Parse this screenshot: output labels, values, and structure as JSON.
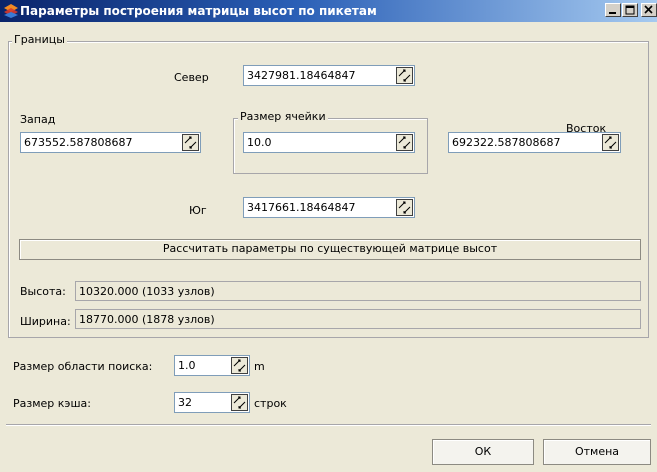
{
  "window": {
    "title": "Параметры построения матрицы высот по пикетам"
  },
  "bounds": {
    "legend": "Границы",
    "north": {
      "label": "Север",
      "value": "3427981.18464847"
    },
    "west": {
      "label": "Запад",
      "value": "673552.587808687"
    },
    "east": {
      "label": "Восток",
      "value": "692322.587808687"
    },
    "south": {
      "label": "Юг",
      "value": "3417661.18464847"
    },
    "cell_size": {
      "legend": "Размер ячейки",
      "value": "10.0"
    },
    "calc_button_label": "Рассчитать параметры по существующей матрице высот",
    "height": {
      "label": "Высота:",
      "value": "10320.000 (1033 узлов)"
    },
    "width": {
      "label": "Ширина:",
      "value": "18770.000 (1878 узлов)"
    }
  },
  "search": {
    "area_label": "Размер области поиска:",
    "area_value": "1.0",
    "area_unit": "m",
    "cache_label": "Размер кэша:",
    "cache_value": "32",
    "cache_unit": "строк"
  },
  "buttons": {
    "ok": "ОК",
    "cancel": "Отмена"
  },
  "icons": {
    "app": "map-layers-icon",
    "spin": "spinner-icon",
    "minimize": "minimize-icon",
    "maximize": "maximize-icon",
    "close": "close-icon"
  }
}
